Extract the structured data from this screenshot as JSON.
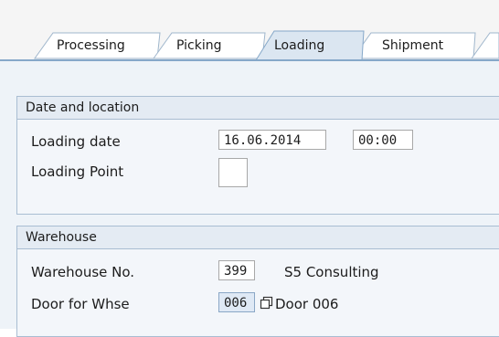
{
  "tabs": [
    {
      "label": "Processing",
      "active": false
    },
    {
      "label": "Picking",
      "active": false
    },
    {
      "label": "Loading",
      "active": true
    },
    {
      "label": "Shipment",
      "active": false
    }
  ],
  "date_location": {
    "title": "Date and location",
    "loading_date_label": "Loading date",
    "loading_date_value": "16.06.2014",
    "loading_time_value": "00:00",
    "loading_point_label": "Loading Point",
    "loading_point_value": ""
  },
  "warehouse": {
    "title": "Warehouse",
    "warehouse_no_label": "Warehouse No.",
    "warehouse_no_value": "399",
    "warehouse_name": "S5 Consulting",
    "door_label": "Door for Whse",
    "door_value": "006",
    "door_description": "Door 006"
  },
  "colors": {
    "active_tab": "#dbe6f1",
    "inactive_tab": "#ffffff",
    "page_background": "#eef3f8",
    "group_header": "#e4ebf3"
  },
  "icons": {
    "value_help": "copy-icon"
  }
}
